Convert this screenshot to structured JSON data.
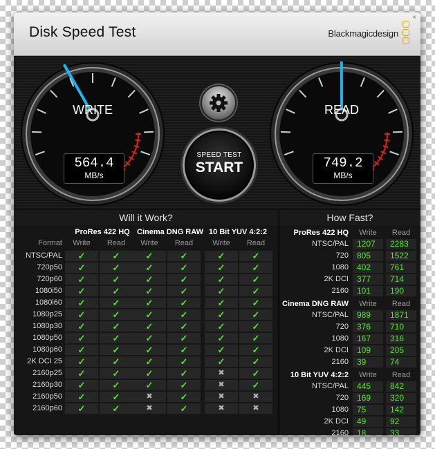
{
  "window": {
    "title": "Disk Speed Test",
    "brand": "Blackmagicdesign",
    "close_glyph": "×"
  },
  "colors": {
    "accent_needle": "#19b6ef",
    "ok_green": "#53e62a",
    "warning_red": "#d9231c",
    "brand_orange": "#e8a300"
  },
  "write_gauge": {
    "label": "WRITE",
    "value": "564.4",
    "unit": "MB/s"
  },
  "read_gauge": {
    "label": "READ",
    "value": "749.2",
    "unit": "MB/s"
  },
  "start_button": {
    "small_label": "SPEED TEST",
    "big_label": "START"
  },
  "settings_button": {
    "icon": "gear-icon"
  },
  "will_it_work": {
    "heading": "Will it Work?",
    "format_label": "Format",
    "codecs": [
      "ProRes 422 HQ",
      "Cinema DNG RAW",
      "10 Bit YUV 4:2:2"
    ],
    "col_labels": [
      "Write",
      "Read",
      "Write",
      "Read",
      "Write",
      "Read"
    ],
    "yes_glyph": "✓",
    "no_glyph": "✖",
    "rows": [
      {
        "name": "NTSC/PAL",
        "cells": [
          true,
          true,
          true,
          true,
          true,
          true
        ]
      },
      {
        "name": "720p50",
        "cells": [
          true,
          true,
          true,
          true,
          true,
          true
        ]
      },
      {
        "name": "720p60",
        "cells": [
          true,
          true,
          true,
          true,
          true,
          true
        ]
      },
      {
        "name": "1080i50",
        "cells": [
          true,
          true,
          true,
          true,
          true,
          true
        ]
      },
      {
        "name": "1080i60",
        "cells": [
          true,
          true,
          true,
          true,
          true,
          true
        ]
      },
      {
        "name": "1080p25",
        "cells": [
          true,
          true,
          true,
          true,
          true,
          true
        ]
      },
      {
        "name": "1080p30",
        "cells": [
          true,
          true,
          true,
          true,
          true,
          true
        ]
      },
      {
        "name": "1080p50",
        "cells": [
          true,
          true,
          true,
          true,
          true,
          true
        ]
      },
      {
        "name": "1080p60",
        "cells": [
          true,
          true,
          true,
          true,
          true,
          true
        ]
      },
      {
        "name": "2K DCI 25",
        "cells": [
          true,
          true,
          true,
          true,
          true,
          true
        ]
      },
      {
        "name": "2160p25",
        "cells": [
          true,
          true,
          true,
          true,
          false,
          true
        ]
      },
      {
        "name": "2160p30",
        "cells": [
          true,
          true,
          true,
          true,
          false,
          true
        ]
      },
      {
        "name": "2160p50",
        "cells": [
          true,
          true,
          false,
          true,
          false,
          false
        ]
      },
      {
        "name": "2160p60",
        "cells": [
          true,
          true,
          false,
          true,
          false,
          false
        ]
      }
    ]
  },
  "how_fast": {
    "heading": "How Fast?",
    "write_label": "Write",
    "read_label": "Read",
    "groups": [
      {
        "title": "ProRes 422 HQ",
        "rows": [
          {
            "name": "NTSC/PAL",
            "write": "1207",
            "read": "2283"
          },
          {
            "name": "720",
            "write": "805",
            "read": "1522"
          },
          {
            "name": "1080",
            "write": "402",
            "read": "761"
          },
          {
            "name": "2K DCI",
            "write": "377",
            "read": "714"
          },
          {
            "name": "2160",
            "write": "101",
            "read": "190"
          }
        ]
      },
      {
        "title": "Cinema DNG RAW",
        "rows": [
          {
            "name": "NTSC/PAL",
            "write": "989",
            "read": "1871"
          },
          {
            "name": "720",
            "write": "376",
            "read": "710"
          },
          {
            "name": "1080",
            "write": "167",
            "read": "316"
          },
          {
            "name": "2K DCI",
            "write": "109",
            "read": "205"
          },
          {
            "name": "2160",
            "write": "39",
            "read": "74"
          }
        ]
      },
      {
        "title": "10 Bit YUV 4:2:2",
        "rows": [
          {
            "name": "NTSC/PAL",
            "write": "445",
            "read": "842"
          },
          {
            "name": "720",
            "write": "169",
            "read": "320"
          },
          {
            "name": "1080",
            "write": "75",
            "read": "142"
          },
          {
            "name": "2K DCI",
            "write": "49",
            "read": "92"
          },
          {
            "name": "2160",
            "write": "18",
            "read": "33"
          }
        ]
      }
    ]
  }
}
